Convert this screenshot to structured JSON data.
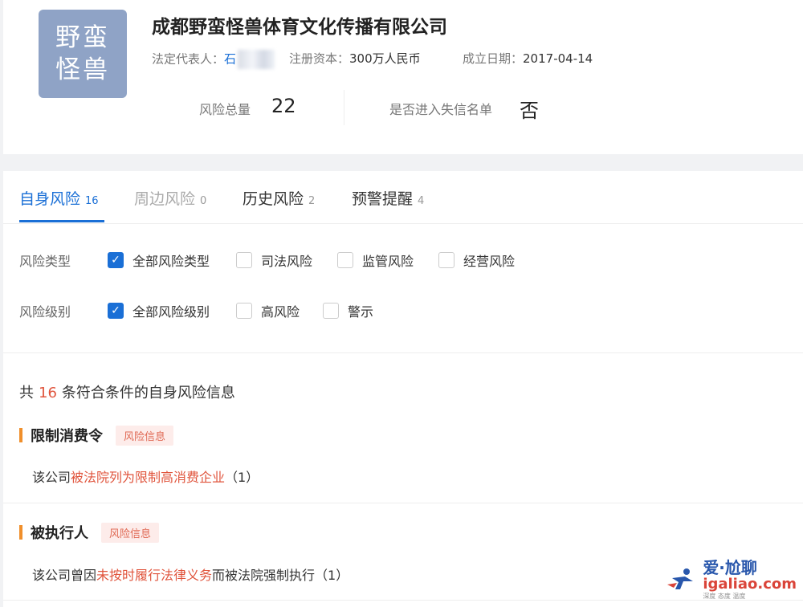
{
  "company": {
    "logo_line1": "野蛮",
    "logo_line2": "怪兽",
    "name": "成都野蛮怪兽体育文化传播有限公司",
    "legal_rep_label": "法定代表人：",
    "legal_rep_value": "石",
    "capital_label": "注册资本：",
    "capital_value": "300万人民币",
    "founded_label": "成立日期：",
    "founded_value": "2017-04-14"
  },
  "stats": {
    "risk_total_label": "风险总量",
    "risk_total_value": "22",
    "dishonest_label": "是否进入失信名单",
    "dishonest_value": "否"
  },
  "tabs": [
    {
      "label": "自身风险",
      "count": "16",
      "state": "active"
    },
    {
      "label": "周边风险",
      "count": "0",
      "state": "muted"
    },
    {
      "label": "历史风险",
      "count": "2",
      "state": "normal"
    },
    {
      "label": "预警提醒",
      "count": "4",
      "state": "normal"
    }
  ],
  "filters": {
    "type_label": "风险类型",
    "type_options": [
      {
        "label": "全部风险类型",
        "checked": true
      },
      {
        "label": "司法风险",
        "checked": false
      },
      {
        "label": "监管风险",
        "checked": false
      },
      {
        "label": "经营风险",
        "checked": false
      }
    ],
    "level_label": "风险级别",
    "level_options": [
      {
        "label": "全部风险级别",
        "checked": true
      },
      {
        "label": "高风险",
        "checked": false
      },
      {
        "label": "警示",
        "checked": false
      }
    ]
  },
  "summary": {
    "prefix": "共",
    "count": "16",
    "suffix": "条符合条件的自身风险信息"
  },
  "sections": [
    {
      "title": "限制消费令",
      "tag": "风险信息",
      "desc_prefix": "该公司",
      "desc_link": "被法院列为限制高消费企业",
      "desc_suffix": "（1）"
    },
    {
      "title": "被执行人",
      "tag": "风险信息",
      "desc_prefix": "该公司曾因",
      "desc_link": "未按时履行法律义务",
      "desc_suffix": "而被法院强制执行（1）"
    }
  ],
  "watermark": {
    "top": "爱·尬聊",
    "url": "igaliao.com",
    "sub": "深度 态度 温度"
  },
  "colors": {
    "accent_blue": "#1a6fd6",
    "risk_red": "#e0543c",
    "section_bar_orange": "#f08f2b",
    "logo_bg": "#8fa3c6"
  }
}
